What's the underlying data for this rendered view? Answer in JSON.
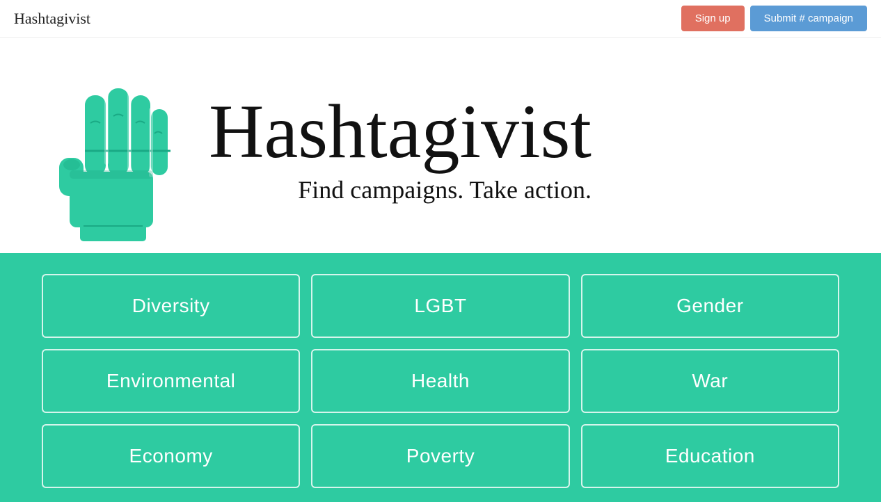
{
  "header": {
    "logo": "Hashtagivist",
    "signup_label": "Sign up",
    "submit_label": "Submit # campaign"
  },
  "hero": {
    "title": "Hashtagivist",
    "subtitle": "Find campaigns. Take action."
  },
  "categories": {
    "items": [
      "Diversity",
      "LGBT",
      "Gender",
      "Environmental",
      "Health",
      "War",
      "Economy",
      "Poverty",
      "Education"
    ]
  }
}
